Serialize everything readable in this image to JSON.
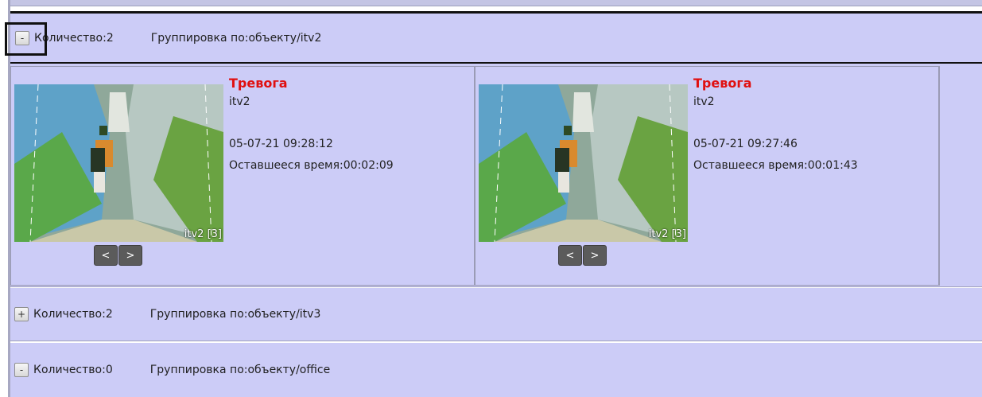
{
  "groups": [
    {
      "toggle": "-",
      "count": "Количество:2",
      "grouping": "Группировка по:объекту/itv2",
      "expanded": true,
      "alarms": [
        {
          "title": "Тревога",
          "object": "itv2",
          "datetime": "05-07-21 09:28:12",
          "remaining": "Оставшееся время:00:02:09",
          "camera_label": "itv2 [3]",
          "prev_label": "<",
          "next_label": ">"
        },
        {
          "title": "Тревога",
          "object": "itv2",
          "datetime": "05-07-21 09:27:46",
          "remaining": "Оставшееся время:00:01:43",
          "camera_label": "itv2 [3]",
          "prev_label": "<",
          "next_label": ">"
        }
      ]
    },
    {
      "toggle": "+",
      "count": "Количество:2",
      "grouping": "Группировка по:объекту/itv3",
      "expanded": false
    },
    {
      "toggle": "-",
      "count": "Количество:0",
      "grouping": "Группировка по:объекту/office",
      "expanded": true
    }
  ],
  "colors": {
    "background": "#ccccf7",
    "alarm_title": "#e01010",
    "nav_button": "#5b5b5b"
  }
}
